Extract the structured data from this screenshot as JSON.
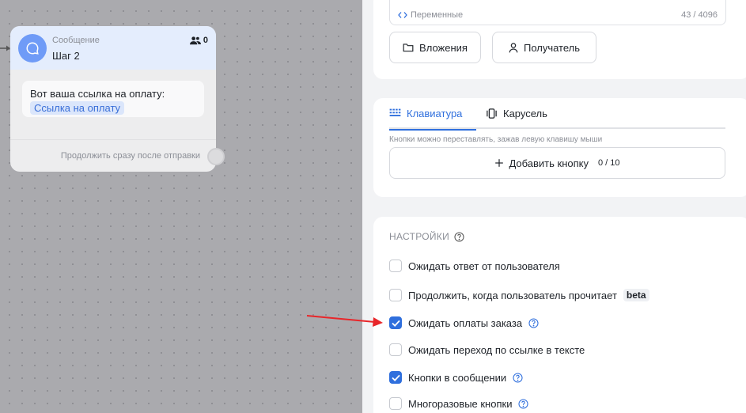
{
  "node": {
    "type_label": "Сообщение",
    "title": "Шаг 2",
    "user_count": "0",
    "message_text": "Вот ваша ссылка на оплату:",
    "link_text": "Ссылка на оплату",
    "continue_label": "Продолжить сразу после отправки"
  },
  "message_card": {
    "variables_label": "Переменные",
    "char_count": "43 / 4096",
    "attachments_button": "Вложения",
    "recipient_button": "Получатель"
  },
  "keyboard_card": {
    "tabs": [
      {
        "label": "Клавиатура",
        "active": true
      },
      {
        "label": "Карусель",
        "active": false
      }
    ],
    "hint": "Кнопки можно переставлять, зажав левую клавишу мыши",
    "add_button_label": "Добавить кнопку",
    "button_count": "0 / 10"
  },
  "settings": {
    "title": "НАСТРОЙКИ",
    "options": [
      {
        "label": "Ожидать ответ от пользователя",
        "checked": false
      },
      {
        "label": "Продолжить, когда пользователь прочитает",
        "badge": "beta",
        "checked": false
      },
      {
        "label": "Ожидать оплаты заказа",
        "checked": true,
        "help": true
      },
      {
        "label": "Ожидать переход по ссылке в тексте",
        "checked": false
      },
      {
        "label": "Кнопки в сообщении",
        "checked": true,
        "help": true
      },
      {
        "label": "Многоразовые кнопки",
        "checked": false,
        "help": true
      }
    ]
  },
  "colors": {
    "accent": "#2f6fdd",
    "annotation_arrow": "#e8262a",
    "node_avatar": "#6f9bf7"
  }
}
